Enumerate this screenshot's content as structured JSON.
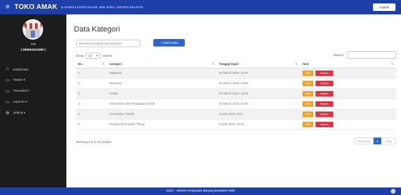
{
  "topbar": {
    "menu_icon": "≡",
    "brand": "TOKO AMAK",
    "address": "JL KURNI 3 RADIO DALAM, KEB. BARU, JAKARTA SELATAN",
    "logout_label": "Logout"
  },
  "sidebar": {
    "user_name": "Tnt",
    "user_id": "( 085691521690 )",
    "items": [
      {
        "icon": "dashboard-icon",
        "glyph": "⌂",
        "label": "Dashboard"
      },
      {
        "icon": "monitor-icon",
        "glyph": "▭",
        "label": "Master ▾"
      },
      {
        "icon": "monitor-icon",
        "glyph": "▭",
        "label": "Transaksi ▾"
      },
      {
        "icon": "monitor-icon",
        "glyph": "▭",
        "label": "Laporan ▾"
      },
      {
        "icon": "gear-icon",
        "glyph": "⚙",
        "label": "Setting ▾"
      }
    ]
  },
  "main": {
    "title": "Data Kategori",
    "search_placeholder": "Masukkan Kategori Barang Baru",
    "insert_label": "+ Insert Data",
    "show_label": "Show",
    "show_value": "10",
    "entries_label": "entries",
    "search_label": "Search:",
    "columns": [
      "No.",
      "Kategori",
      "Tanggal Input",
      "Aksi"
    ],
    "sort_glyph": "⇅",
    "rows": [
      {
        "no": "1",
        "kategori": "Makanan",
        "tanggal": "31 March 2023, 14:27"
      },
      {
        "no": "2",
        "kategori": "Minuman",
        "tanggal": "31 March 2023, 15:54"
      },
      {
        "no": "3",
        "kategori": "Rokok",
        "tanggal": "31 March 2023, 15:54"
      },
      {
        "no": "4",
        "kategori": "Kebersihan dan Perawatan Tubuh",
        "tanggal": "31 March 2023, 15:54"
      },
      {
        "no": "5",
        "kategori": "Kesehatan / Medis",
        "tanggal": "6 April 2023, 8:52"
      },
      {
        "no": "6",
        "kategori": "Pembersih Rumah / Piring",
        "tanggal": "6 April 2023, 15:31"
      }
    ],
    "edit_label": "Edit",
    "delete_label": "Hapus",
    "info": "Showing 1 to 6 of 6 entries",
    "prev_label": "Previous",
    "page_label": "1",
    "next_label": "Next"
  },
  "footer": {
    "text": "2023 - Sistem Penjualan Barang Berbasis Web"
  },
  "colors": {
    "primary": "#1f3fa8",
    "sidebar": "#1c1c1c",
    "edit": "#f0a430",
    "delete": "#dc3545"
  }
}
